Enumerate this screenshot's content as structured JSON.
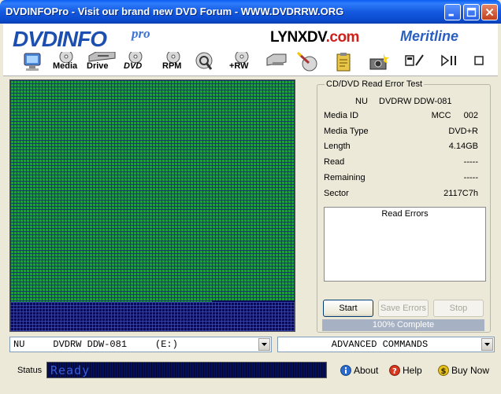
{
  "window": {
    "title": "DVDINFOPro  -  Visit our brand new DVD Forum  -  WWW.DVDRRW.ORG"
  },
  "banner": {
    "logo_main": "DVDINFO",
    "logo_pro": "pro",
    "sponsor_1_main": "LYNXDV",
    "sponsor_1_suffix": ".com",
    "sponsor_2": "Meritline"
  },
  "toolbar": {
    "items": [
      {
        "icon": "monitor-icon",
        "label": ""
      },
      {
        "icon": "media-disc-icon",
        "label": "Media"
      },
      {
        "icon": "drive-icon",
        "label": "Drive"
      },
      {
        "icon": "dvd-disc-icon",
        "label": "DVD"
      },
      {
        "icon": "rpm-disc-icon",
        "label": "RPM"
      },
      {
        "icon": "magnifier-disc-icon",
        "label": ""
      },
      {
        "icon": "plus-rw-disc-icon",
        "label": "+RW"
      },
      {
        "icon": "drive-tray-icon",
        "label": ""
      },
      {
        "icon": "brush-disc-icon",
        "label": ""
      },
      {
        "icon": "clipboard-icon",
        "label": ""
      },
      {
        "icon": "camera-icon",
        "label": ""
      },
      {
        "icon": "save-edit-icon",
        "label": ""
      },
      {
        "icon": "stop-play-icon",
        "label": ""
      },
      {
        "icon": "window-restore-icon",
        "label": ""
      }
    ]
  },
  "test_panel": {
    "title": "CD/DVD Read Error Test",
    "drive_vendor": "NU",
    "drive_model": "DVDRW DDW-081",
    "fields": [
      {
        "label": "Media ID",
        "value": "MCC",
        "value2": "002"
      },
      {
        "label": "Media Type",
        "value": "DVD+R"
      },
      {
        "label": "Length",
        "value": "4.14GB"
      },
      {
        "label": "Read",
        "value": "-----"
      },
      {
        "label": "Remaining",
        "value": "-----"
      },
      {
        "label": "Sector",
        "value": "2117C7h"
      }
    ],
    "read_errors_title": "Read Errors",
    "buttons": {
      "start": "Start",
      "save_errors": "Save Errors",
      "stop": "Stop"
    },
    "progress_label": "100% Complete",
    "progress_fraction": 1.0
  },
  "drive_select": {
    "value": "NU     DVDRW DDW-081     (E:)"
  },
  "commands_select": {
    "value": "ADVANCED COMMANDS"
  },
  "status": {
    "label": "Status",
    "text": "Ready"
  },
  "links": {
    "about": "About",
    "help": "Help",
    "buy_now": "Buy Now"
  },
  "colors": {
    "good_sector": "#1f9c3f",
    "unread_sector": "#0a0a5a",
    "titlebar": "#0b4cd0"
  }
}
